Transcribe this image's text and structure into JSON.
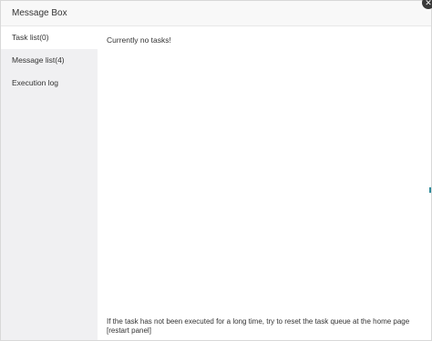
{
  "window": {
    "title": "Message Box",
    "close_label": "✕"
  },
  "sidebar": {
    "items": [
      {
        "label": "Task list(0)",
        "active": true
      },
      {
        "label": "Message list(4)",
        "active": false
      },
      {
        "label": "Execution log",
        "active": false
      }
    ]
  },
  "main": {
    "empty_message": "Currently no tasks!",
    "footer_note": "If the task has not been executed for a long time, try to reset the task queue at the home page [restart panel]"
  },
  "colors": {
    "header_bg": "#f8f8f8",
    "sidebar_bg": "#f0f0f2",
    "active_item_bg": "#ffffff",
    "text": "#333333",
    "close_button": "#3a3a3a"
  }
}
